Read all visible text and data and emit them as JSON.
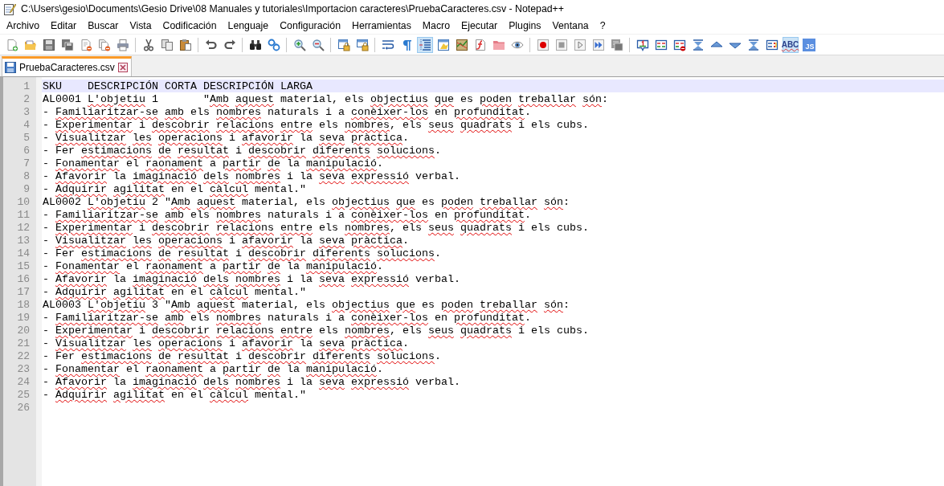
{
  "window": {
    "title": "C:\\Users\\gesio\\Documents\\Gesio Drive\\08 Manuales y tutoriales\\Importacion caracteres\\PruebaCaracteres.csv - Notepad++"
  },
  "menu": [
    "Archivo",
    "Editar",
    "Buscar",
    "Vista",
    "Codificación",
    "Lenguaje",
    "Configuración",
    "Herramientas",
    "Macro",
    "Ejecutar",
    "Plugins",
    "Ventana",
    "?"
  ],
  "toolbar": [
    {
      "kind": "new",
      "pressed": false
    },
    {
      "kind": "open",
      "pressed": false
    },
    {
      "kind": "save",
      "pressed": false
    },
    {
      "kind": "saveall",
      "pressed": false
    },
    {
      "kind": "close",
      "pressed": false
    },
    {
      "kind": "closeall",
      "pressed": false
    },
    {
      "kind": "print",
      "pressed": false
    },
    {
      "kind": "separator"
    },
    {
      "kind": "cut",
      "pressed": false
    },
    {
      "kind": "copy",
      "pressed": false
    },
    {
      "kind": "paste",
      "pressed": false
    },
    {
      "kind": "separator"
    },
    {
      "kind": "undo",
      "pressed": false
    },
    {
      "kind": "redo",
      "pressed": false
    },
    {
      "kind": "separator"
    },
    {
      "kind": "find",
      "pressed": false
    },
    {
      "kind": "replace",
      "pressed": false
    },
    {
      "kind": "separator"
    },
    {
      "kind": "zoomin",
      "pressed": false
    },
    {
      "kind": "zoomout",
      "pressed": false
    },
    {
      "kind": "separator"
    },
    {
      "kind": "lockv",
      "pressed": false
    },
    {
      "kind": "lockh",
      "pressed": false
    },
    {
      "kind": "separator"
    },
    {
      "kind": "wrap",
      "pressed": false
    },
    {
      "kind": "pilcrow",
      "pressed": false
    },
    {
      "kind": "indent",
      "pressed": true
    },
    {
      "kind": "udl",
      "pressed": false
    },
    {
      "kind": "map",
      "pressed": false
    },
    {
      "kind": "funclist",
      "pressed": false
    },
    {
      "kind": "folder",
      "pressed": false
    },
    {
      "kind": "eye",
      "pressed": false
    },
    {
      "kind": "separator"
    },
    {
      "kind": "record",
      "pressed": false
    },
    {
      "kind": "stop",
      "pressed": false
    },
    {
      "kind": "play",
      "pressed": false
    },
    {
      "kind": "playmulti",
      "pressed": false
    },
    {
      "kind": "savemacro",
      "pressed": false
    },
    {
      "kind": "separator"
    },
    {
      "kind": "bubble",
      "pressed": false
    },
    {
      "kind": "compare",
      "pressed": false
    },
    {
      "kind": "compareclear",
      "pressed": false
    },
    {
      "kind": "first",
      "pressed": false
    },
    {
      "kind": "up",
      "pressed": false
    },
    {
      "kind": "down",
      "pressed": false
    },
    {
      "kind": "last",
      "pressed": false
    },
    {
      "kind": "panel",
      "pressed": false
    },
    {
      "kind": "spellcheck",
      "label": "ABC",
      "pressed": true
    },
    {
      "kind": "js",
      "label": "JS",
      "pressed": false
    }
  ],
  "tabs": [
    {
      "label": "PruebaCaracteres.csv",
      "selected": true
    }
  ],
  "editor": {
    "lines": [
      {
        "number": "1",
        "current": true,
        "segments": [
          {
            "text": "SKU    DESCRIPCIÓN CORTA DESCRIPCIÓN LARGA",
            "misspelled": false
          }
        ]
      },
      {
        "number": "2",
        "current": false,
        "segments": [
          {
            "text": "AL0001 ",
            "misspelled": false
          },
          {
            "text": "L'objetiu",
            "misspelled": true
          },
          {
            "text": " 1       \"",
            "misspelled": false
          },
          {
            "text": "Amb ",
            "misspelled": true
          },
          {
            "text": "aquest",
            "misspelled": true
          },
          {
            "text": " material, els ",
            "misspelled": false
          },
          {
            "text": "objectius ",
            "misspelled": true
          },
          {
            "text": "que",
            "misspelled": true
          },
          {
            "text": " es ",
            "misspelled": false
          },
          {
            "text": "poden ",
            "misspelled": true
          },
          {
            "text": "treballar ",
            "misspelled": true
          },
          {
            "text": "són",
            "misspelled": true
          },
          {
            "text": ":",
            "misspelled": false
          }
        ]
      },
      {
        "number": "3",
        "current": false,
        "segments": [
          {
            "text": "- ",
            "misspelled": false
          },
          {
            "text": "Familiaritzar-se ",
            "misspelled": true
          },
          {
            "text": "amb",
            "misspelled": true
          },
          {
            "text": " els ",
            "misspelled": false
          },
          {
            "text": "nombres",
            "misspelled": true
          },
          {
            "text": " naturals i a ",
            "misspelled": false
          },
          {
            "text": "conèixer-los",
            "misspelled": true
          },
          {
            "text": " en ",
            "misspelled": false
          },
          {
            "text": "profunditat",
            "misspelled": true
          },
          {
            "text": ".",
            "misspelled": false
          }
        ]
      },
      {
        "number": "4",
        "current": false,
        "segments": [
          {
            "text": "- ",
            "misspelled": false
          },
          {
            "text": "Experimentar",
            "misspelled": true
          },
          {
            "text": " i ",
            "misspelled": false
          },
          {
            "text": "descobrir ",
            "misspelled": true
          },
          {
            "text": "relacions ",
            "misspelled": true
          },
          {
            "text": "entre",
            "misspelled": true
          },
          {
            "text": " els ",
            "misspelled": false
          },
          {
            "text": "nombres",
            "misspelled": true
          },
          {
            "text": ", els ",
            "misspelled": false
          },
          {
            "text": "seus ",
            "misspelled": true
          },
          {
            "text": "quadrats",
            "misspelled": true
          },
          {
            "text": " i els cubs.",
            "misspelled": false
          }
        ]
      },
      {
        "number": "5",
        "current": false,
        "segments": [
          {
            "text": "- ",
            "misspelled": false
          },
          {
            "text": "Visualitzar ",
            "misspelled": true
          },
          {
            "text": "les ",
            "misspelled": true
          },
          {
            "text": "operacions",
            "misspelled": true
          },
          {
            "text": " i ",
            "misspelled": false
          },
          {
            "text": "afavorir",
            "misspelled": true
          },
          {
            "text": " la ",
            "misspelled": false
          },
          {
            "text": "seva ",
            "misspelled": true
          },
          {
            "text": "pràctica",
            "misspelled": true
          },
          {
            "text": ".",
            "misspelled": false
          }
        ]
      },
      {
        "number": "6",
        "current": false,
        "segments": [
          {
            "text": "- Fer ",
            "misspelled": false
          },
          {
            "text": "estimacions ",
            "misspelled": true
          },
          {
            "text": "de ",
            "misspelled": true
          },
          {
            "text": "resultat",
            "misspelled": true
          },
          {
            "text": " i ",
            "misspelled": false
          },
          {
            "text": "descobrir ",
            "misspelled": true
          },
          {
            "text": "diferents ",
            "misspelled": true
          },
          {
            "text": "solucions",
            "misspelled": true
          },
          {
            "text": ".",
            "misspelled": false
          }
        ]
      },
      {
        "number": "7",
        "current": false,
        "segments": [
          {
            "text": "- ",
            "misspelled": false
          },
          {
            "text": "Fonamentar",
            "misspelled": true
          },
          {
            "text": " el ",
            "misspelled": false
          },
          {
            "text": "raonament",
            "misspelled": true
          },
          {
            "text": " a ",
            "misspelled": false
          },
          {
            "text": "partir ",
            "misspelled": true
          },
          {
            "text": "de",
            "misspelled": true
          },
          {
            "text": " la ",
            "misspelled": false
          },
          {
            "text": "manipulació",
            "misspelled": true
          },
          {
            "text": ".",
            "misspelled": false
          }
        ]
      },
      {
        "number": "8",
        "current": false,
        "segments": [
          {
            "text": "- ",
            "misspelled": false
          },
          {
            "text": "Afavorir",
            "misspelled": true
          },
          {
            "text": " la ",
            "misspelled": false
          },
          {
            "text": "imaginació ",
            "misspelled": true
          },
          {
            "text": "dels ",
            "misspelled": true
          },
          {
            "text": "nombres",
            "misspelled": true
          },
          {
            "text": " i la ",
            "misspelled": false
          },
          {
            "text": "seva ",
            "misspelled": true
          },
          {
            "text": "expressió",
            "misspelled": true
          },
          {
            "text": " verbal.",
            "misspelled": false
          }
        ]
      },
      {
        "number": "9",
        "current": false,
        "segments": [
          {
            "text": "- ",
            "misspelled": false
          },
          {
            "text": "Adquirir ",
            "misspelled": true
          },
          {
            "text": "agilitat",
            "misspelled": true
          },
          {
            "text": " en el ",
            "misspelled": false
          },
          {
            "text": "càlcul",
            "misspelled": true
          },
          {
            "text": " mental.\"",
            "misspelled": false
          }
        ]
      },
      {
        "number": "10",
        "current": false,
        "segments": [
          {
            "text": "AL0002 ",
            "misspelled": false
          },
          {
            "text": "L'objetiu",
            "misspelled": true
          },
          {
            "text": " 2 \"",
            "misspelled": false
          },
          {
            "text": "Amb ",
            "misspelled": true
          },
          {
            "text": "aquest",
            "misspelled": true
          },
          {
            "text": " material, els ",
            "misspelled": false
          },
          {
            "text": "objectius ",
            "misspelled": true
          },
          {
            "text": "que",
            "misspelled": true
          },
          {
            "text": " es ",
            "misspelled": false
          },
          {
            "text": "poden ",
            "misspelled": true
          },
          {
            "text": "treballar ",
            "misspelled": true
          },
          {
            "text": "són",
            "misspelled": true
          },
          {
            "text": ":",
            "misspelled": false
          }
        ]
      },
      {
        "number": "11",
        "current": false,
        "segments": [
          {
            "text": "- ",
            "misspelled": false
          },
          {
            "text": "Familiaritzar-se ",
            "misspelled": true
          },
          {
            "text": "amb",
            "misspelled": true
          },
          {
            "text": " els ",
            "misspelled": false
          },
          {
            "text": "nombres",
            "misspelled": true
          },
          {
            "text": " naturals i a ",
            "misspelled": false
          },
          {
            "text": "conèixer-los",
            "misspelled": true
          },
          {
            "text": " en ",
            "misspelled": false
          },
          {
            "text": "profunditat",
            "misspelled": true
          },
          {
            "text": ".",
            "misspelled": false
          }
        ]
      },
      {
        "number": "12",
        "current": false,
        "segments": [
          {
            "text": "- ",
            "misspelled": false
          },
          {
            "text": "Experimentar",
            "misspelled": true
          },
          {
            "text": " i ",
            "misspelled": false
          },
          {
            "text": "descobrir ",
            "misspelled": true
          },
          {
            "text": "relacions ",
            "misspelled": true
          },
          {
            "text": "entre",
            "misspelled": true
          },
          {
            "text": " els ",
            "misspelled": false
          },
          {
            "text": "nombres",
            "misspelled": true
          },
          {
            "text": ", els ",
            "misspelled": false
          },
          {
            "text": "seus ",
            "misspelled": true
          },
          {
            "text": "quadrats",
            "misspelled": true
          },
          {
            "text": " i els cubs.",
            "misspelled": false
          }
        ]
      },
      {
        "number": "13",
        "current": false,
        "segments": [
          {
            "text": "- ",
            "misspelled": false
          },
          {
            "text": "Visualitzar ",
            "misspelled": true
          },
          {
            "text": "les ",
            "misspelled": true
          },
          {
            "text": "operacions",
            "misspelled": true
          },
          {
            "text": " i ",
            "misspelled": false
          },
          {
            "text": "afavorir",
            "misspelled": true
          },
          {
            "text": " la ",
            "misspelled": false
          },
          {
            "text": "seva ",
            "misspelled": true
          },
          {
            "text": "pràctica",
            "misspelled": true
          },
          {
            "text": ".",
            "misspelled": false
          }
        ]
      },
      {
        "number": "14",
        "current": false,
        "segments": [
          {
            "text": "- Fer ",
            "misspelled": false
          },
          {
            "text": "estimacions ",
            "misspelled": true
          },
          {
            "text": "de ",
            "misspelled": true
          },
          {
            "text": "resultat",
            "misspelled": true
          },
          {
            "text": " i ",
            "misspelled": false
          },
          {
            "text": "descobrir ",
            "misspelled": true
          },
          {
            "text": "diferents ",
            "misspelled": true
          },
          {
            "text": "solucions",
            "misspelled": true
          },
          {
            "text": ".",
            "misspelled": false
          }
        ]
      },
      {
        "number": "15",
        "current": false,
        "segments": [
          {
            "text": "- ",
            "misspelled": false
          },
          {
            "text": "Fonamentar",
            "misspelled": true
          },
          {
            "text": " el ",
            "misspelled": false
          },
          {
            "text": "raonament",
            "misspelled": true
          },
          {
            "text": " a ",
            "misspelled": false
          },
          {
            "text": "partir ",
            "misspelled": true
          },
          {
            "text": "de",
            "misspelled": true
          },
          {
            "text": " la ",
            "misspelled": false
          },
          {
            "text": "manipulació",
            "misspelled": true
          },
          {
            "text": ".",
            "misspelled": false
          }
        ]
      },
      {
        "number": "16",
        "current": false,
        "segments": [
          {
            "text": "- ",
            "misspelled": false
          },
          {
            "text": "Afavorir",
            "misspelled": true
          },
          {
            "text": " la ",
            "misspelled": false
          },
          {
            "text": "imaginació ",
            "misspelled": true
          },
          {
            "text": "dels ",
            "misspelled": true
          },
          {
            "text": "nombres",
            "misspelled": true
          },
          {
            "text": " i la ",
            "misspelled": false
          },
          {
            "text": "seva ",
            "misspelled": true
          },
          {
            "text": "expressió",
            "misspelled": true
          },
          {
            "text": " verbal.",
            "misspelled": false
          }
        ]
      },
      {
        "number": "17",
        "current": false,
        "segments": [
          {
            "text": "- ",
            "misspelled": false
          },
          {
            "text": "Adquirir ",
            "misspelled": true
          },
          {
            "text": "agilitat",
            "misspelled": true
          },
          {
            "text": " en el ",
            "misspelled": false
          },
          {
            "text": "càlcul",
            "misspelled": true
          },
          {
            "text": " mental.\"",
            "misspelled": false
          }
        ]
      },
      {
        "number": "18",
        "current": false,
        "segments": [
          {
            "text": "AL0003 ",
            "misspelled": false
          },
          {
            "text": "L'objetiu",
            "misspelled": true
          },
          {
            "text": " 3 \"",
            "misspelled": false
          },
          {
            "text": "Amb ",
            "misspelled": true
          },
          {
            "text": "aquest",
            "misspelled": true
          },
          {
            "text": " material, els ",
            "misspelled": false
          },
          {
            "text": "objectius ",
            "misspelled": true
          },
          {
            "text": "que",
            "misspelled": true
          },
          {
            "text": " es ",
            "misspelled": false
          },
          {
            "text": "poden ",
            "misspelled": true
          },
          {
            "text": "treballar ",
            "misspelled": true
          },
          {
            "text": "són",
            "misspelled": true
          },
          {
            "text": ":",
            "misspelled": false
          }
        ]
      },
      {
        "number": "19",
        "current": false,
        "segments": [
          {
            "text": "- ",
            "misspelled": false
          },
          {
            "text": "Familiaritzar-se ",
            "misspelled": true
          },
          {
            "text": "amb",
            "misspelled": true
          },
          {
            "text": " els ",
            "misspelled": false
          },
          {
            "text": "nombres",
            "misspelled": true
          },
          {
            "text": " naturals i a ",
            "misspelled": false
          },
          {
            "text": "conèixer-los",
            "misspelled": true
          },
          {
            "text": " en ",
            "misspelled": false
          },
          {
            "text": "profunditat",
            "misspelled": true
          },
          {
            "text": ".",
            "misspelled": false
          }
        ]
      },
      {
        "number": "20",
        "current": false,
        "segments": [
          {
            "text": "- ",
            "misspelled": false
          },
          {
            "text": "Experimentar",
            "misspelled": true
          },
          {
            "text": " i ",
            "misspelled": false
          },
          {
            "text": "descobrir ",
            "misspelled": true
          },
          {
            "text": "relacions ",
            "misspelled": true
          },
          {
            "text": "entre",
            "misspelled": true
          },
          {
            "text": " els ",
            "misspelled": false
          },
          {
            "text": "nombres",
            "misspelled": true
          },
          {
            "text": ", els ",
            "misspelled": false
          },
          {
            "text": "seus ",
            "misspelled": true
          },
          {
            "text": "quadrats",
            "misspelled": true
          },
          {
            "text": " i els cubs.",
            "misspelled": false
          }
        ]
      },
      {
        "number": "21",
        "current": false,
        "segments": [
          {
            "text": "- ",
            "misspelled": false
          },
          {
            "text": "Visualitzar ",
            "misspelled": true
          },
          {
            "text": "les ",
            "misspelled": true
          },
          {
            "text": "operacions",
            "misspelled": true
          },
          {
            "text": " i ",
            "misspelled": false
          },
          {
            "text": "afavorir",
            "misspelled": true
          },
          {
            "text": " la ",
            "misspelled": false
          },
          {
            "text": "seva ",
            "misspelled": true
          },
          {
            "text": "pràctica",
            "misspelled": true
          },
          {
            "text": ".",
            "misspelled": false
          }
        ]
      },
      {
        "number": "22",
        "current": false,
        "segments": [
          {
            "text": "- Fer ",
            "misspelled": false
          },
          {
            "text": "estimacions ",
            "misspelled": true
          },
          {
            "text": "de ",
            "misspelled": true
          },
          {
            "text": "resultat",
            "misspelled": true
          },
          {
            "text": " i ",
            "misspelled": false
          },
          {
            "text": "descobrir ",
            "misspelled": true
          },
          {
            "text": "diferents ",
            "misspelled": true
          },
          {
            "text": "solucions",
            "misspelled": true
          },
          {
            "text": ".",
            "misspelled": false
          }
        ]
      },
      {
        "number": "23",
        "current": false,
        "segments": [
          {
            "text": "- ",
            "misspelled": false
          },
          {
            "text": "Fonamentar",
            "misspelled": true
          },
          {
            "text": " el ",
            "misspelled": false
          },
          {
            "text": "raonament",
            "misspelled": true
          },
          {
            "text": " a ",
            "misspelled": false
          },
          {
            "text": "partir ",
            "misspelled": true
          },
          {
            "text": "de",
            "misspelled": true
          },
          {
            "text": " la ",
            "misspelled": false
          },
          {
            "text": "manipulació",
            "misspelled": true
          },
          {
            "text": ".",
            "misspelled": false
          }
        ]
      },
      {
        "number": "24",
        "current": false,
        "segments": [
          {
            "text": "- ",
            "misspelled": false
          },
          {
            "text": "Afavorir",
            "misspelled": true
          },
          {
            "text": " la ",
            "misspelled": false
          },
          {
            "text": "imaginació ",
            "misspelled": true
          },
          {
            "text": "dels ",
            "misspelled": true
          },
          {
            "text": "nombres",
            "misspelled": true
          },
          {
            "text": " i la ",
            "misspelled": false
          },
          {
            "text": "seva ",
            "misspelled": true
          },
          {
            "text": "expressió",
            "misspelled": true
          },
          {
            "text": " verbal.",
            "misspelled": false
          }
        ]
      },
      {
        "number": "25",
        "current": false,
        "segments": [
          {
            "text": "- ",
            "misspelled": false
          },
          {
            "text": "Adquirir ",
            "misspelled": true
          },
          {
            "text": "agilitat",
            "misspelled": true
          },
          {
            "text": " en el ",
            "misspelled": false
          },
          {
            "text": "càlcul",
            "misspelled": true
          },
          {
            "text": " mental.\"",
            "misspelled": false
          }
        ]
      },
      {
        "number": "26",
        "current": false
      }
    ]
  }
}
